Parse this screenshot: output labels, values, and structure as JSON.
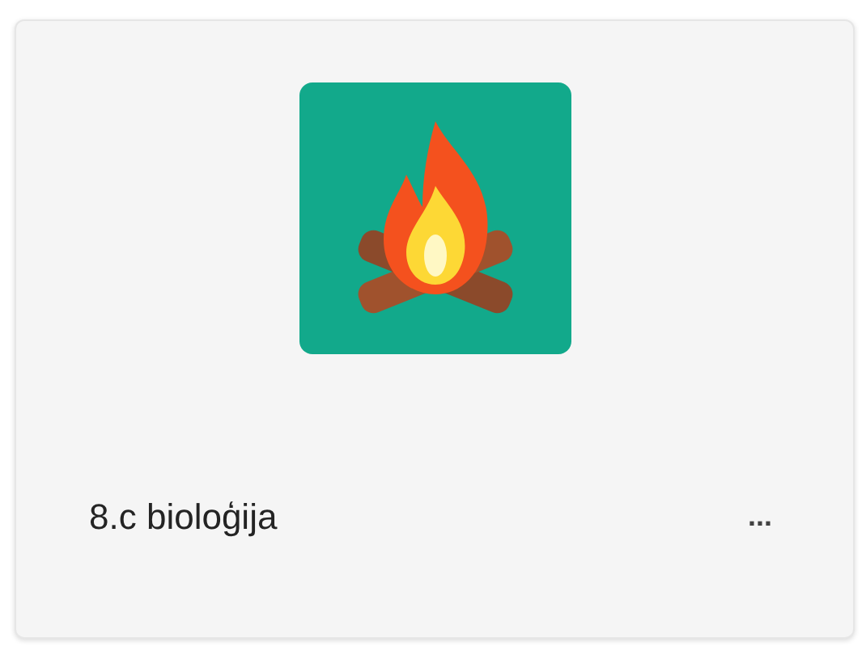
{
  "team": {
    "name": "8.c bioloģija",
    "more": "..."
  }
}
